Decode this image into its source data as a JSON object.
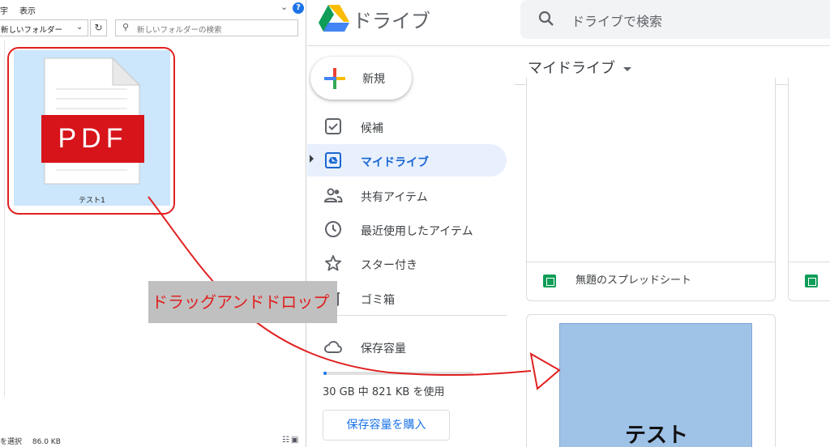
{
  "explorer": {
    "menu": [
      "ﾌｧｲﾙ",
      "表示"
    ],
    "menu_visible": [
      "宇",
      "表示"
    ],
    "address": "新しいフォルダー",
    "search_placeholder": "新しいフォルダーの検索",
    "file": {
      "name": "テスト1",
      "type_label": "PDF"
    },
    "status": [
      "を選択",
      "86.0 KB"
    ]
  },
  "drive": {
    "product_name": "ドライブ",
    "search_placeholder": "ドライブで検索",
    "new_label": "新規",
    "nav": [
      {
        "label": "候補",
        "icon": "suggested-icon"
      },
      {
        "label": "マイドライブ",
        "icon": "my-drive-icon"
      },
      {
        "label": "共有アイテム",
        "icon": "shared-icon"
      },
      {
        "label": "最近使用したアイテム",
        "icon": "clock-icon"
      },
      {
        "label": "スター付き",
        "icon": "star-icon"
      },
      {
        "label": "ゴミ箱",
        "icon": "trash-icon"
      }
    ],
    "storage_label": "保存容量",
    "storage_text": "30 GB 中 821 KB を使用",
    "storage_fraction": 0.02,
    "buy_label": "保存容量を購入",
    "content_title": "マイドライブ",
    "files": [
      {
        "name": "無題のスプレッドシート",
        "type": "spreadsheet"
      },
      {
        "name": "",
        "type": "spreadsheet"
      }
    ],
    "dropped_thumbnail_text": "テスト"
  },
  "annotation": {
    "label": "ドラッグアンドドロップ",
    "color": "#e02020"
  },
  "colors": {
    "accent": "#1a73e8",
    "active_bg": "#e8f0fe",
    "selection_bg": "#cce6fb",
    "pdf_red": "#d7141a",
    "sheets_green": "#0f9d58"
  }
}
